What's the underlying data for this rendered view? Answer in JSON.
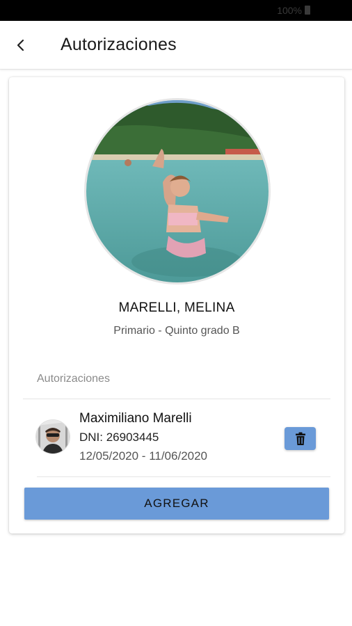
{
  "status_bar": {
    "battery": "100%"
  },
  "app_bar": {
    "title": "Autorizaciones",
    "back_icon": "chevron-left-icon"
  },
  "student": {
    "name": "MARELLI, MELINA",
    "grade": "Primario - Quinto grado B"
  },
  "authorizations": {
    "section_label": "Autorizaciones",
    "items": [
      {
        "name": "Maximiliano Marelli",
        "dni": "DNI: 26903445",
        "dates": "12/05/2020 - 11/06/2020",
        "delete_icon": "trash-icon"
      }
    ],
    "add_button": "AGREGAR"
  },
  "colors": {
    "accent": "#6a9ad8",
    "status_bar": "#000000"
  }
}
